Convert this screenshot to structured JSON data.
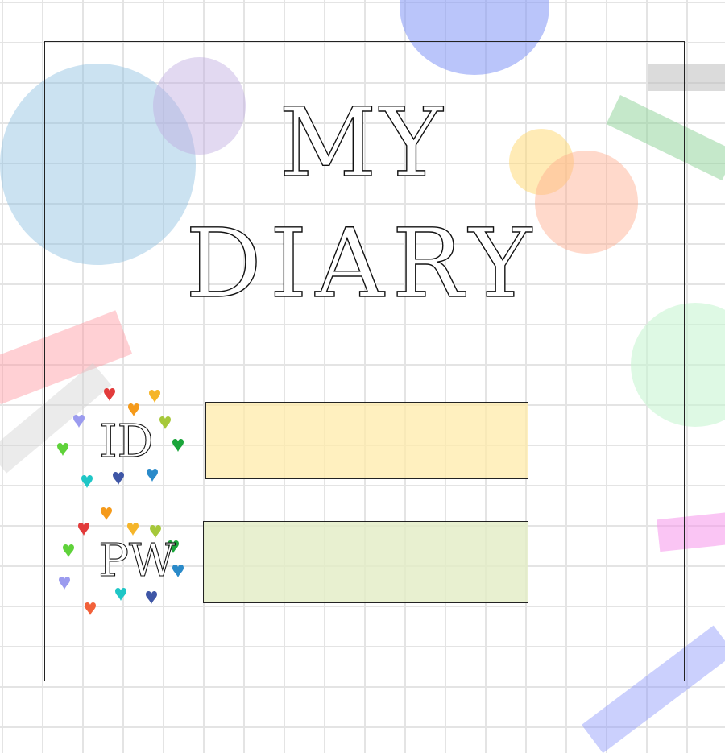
{
  "title": {
    "line1": "MY",
    "line2": "DIARY"
  },
  "fields": {
    "id": {
      "label": "ID",
      "value": "",
      "placeholder": ""
    },
    "pw": {
      "label": "PW",
      "value": "",
      "placeholder": ""
    }
  },
  "colors": {
    "id_field": "#fff0c0",
    "pw_field": "#e8efcf",
    "grid": "#e4e4e4"
  }
}
